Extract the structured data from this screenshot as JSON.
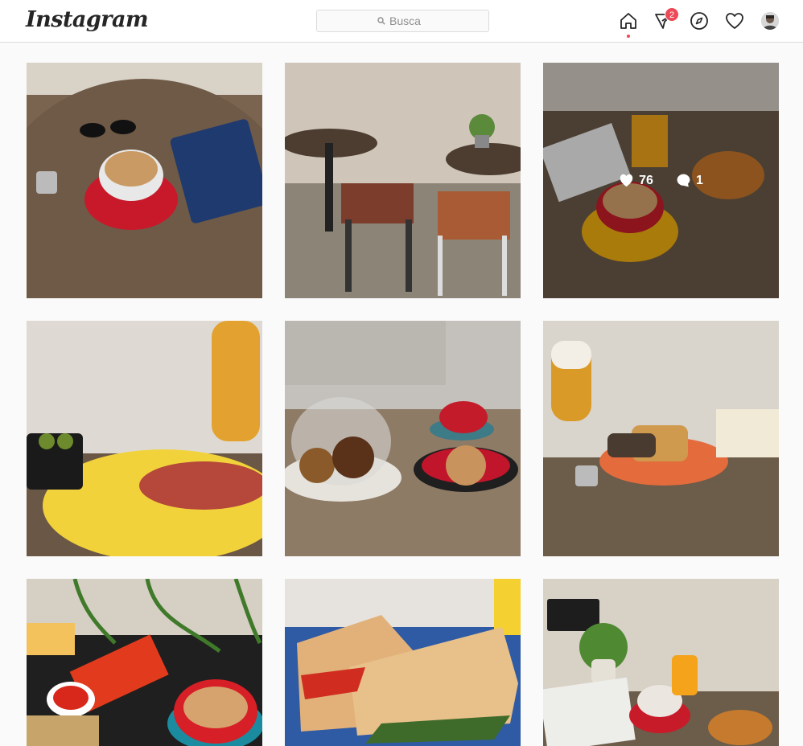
{
  "app": {
    "logo_text": "Instagram"
  },
  "search": {
    "placeholder": "Busca"
  },
  "nav": {
    "direct_badge": "2",
    "icons": [
      "home-icon",
      "direct-icon",
      "explore-icon",
      "activity-icon",
      "profile-avatar"
    ]
  },
  "hover_stats": {
    "likes": "76",
    "comments": "1"
  },
  "colors": {
    "accent": "#ed4956",
    "border": "#dbdbdb",
    "text": "#262626"
  }
}
